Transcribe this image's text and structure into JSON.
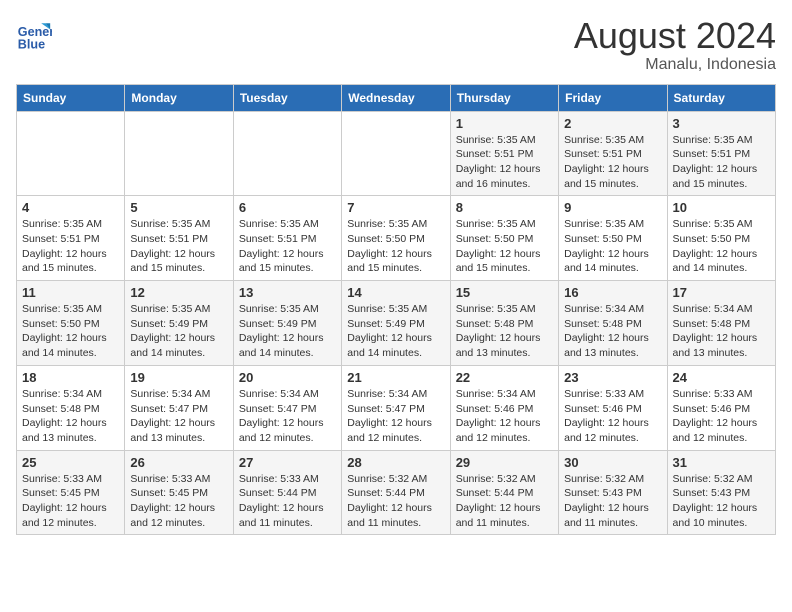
{
  "header": {
    "logo_line1": "General",
    "logo_line2": "Blue",
    "month_year": "August 2024",
    "location": "Manalu, Indonesia"
  },
  "weekdays": [
    "Sunday",
    "Monday",
    "Tuesday",
    "Wednesday",
    "Thursday",
    "Friday",
    "Saturday"
  ],
  "weeks": [
    [
      {
        "day": "",
        "info": ""
      },
      {
        "day": "",
        "info": ""
      },
      {
        "day": "",
        "info": ""
      },
      {
        "day": "",
        "info": ""
      },
      {
        "day": "1",
        "info": "Sunrise: 5:35 AM\nSunset: 5:51 PM\nDaylight: 12 hours\nand 16 minutes."
      },
      {
        "day": "2",
        "info": "Sunrise: 5:35 AM\nSunset: 5:51 PM\nDaylight: 12 hours\nand 15 minutes."
      },
      {
        "day": "3",
        "info": "Sunrise: 5:35 AM\nSunset: 5:51 PM\nDaylight: 12 hours\nand 15 minutes."
      }
    ],
    [
      {
        "day": "4",
        "info": "Sunrise: 5:35 AM\nSunset: 5:51 PM\nDaylight: 12 hours\nand 15 minutes."
      },
      {
        "day": "5",
        "info": "Sunrise: 5:35 AM\nSunset: 5:51 PM\nDaylight: 12 hours\nand 15 minutes."
      },
      {
        "day": "6",
        "info": "Sunrise: 5:35 AM\nSunset: 5:51 PM\nDaylight: 12 hours\nand 15 minutes."
      },
      {
        "day": "7",
        "info": "Sunrise: 5:35 AM\nSunset: 5:50 PM\nDaylight: 12 hours\nand 15 minutes."
      },
      {
        "day": "8",
        "info": "Sunrise: 5:35 AM\nSunset: 5:50 PM\nDaylight: 12 hours\nand 15 minutes."
      },
      {
        "day": "9",
        "info": "Sunrise: 5:35 AM\nSunset: 5:50 PM\nDaylight: 12 hours\nand 14 minutes."
      },
      {
        "day": "10",
        "info": "Sunrise: 5:35 AM\nSunset: 5:50 PM\nDaylight: 12 hours\nand 14 minutes."
      }
    ],
    [
      {
        "day": "11",
        "info": "Sunrise: 5:35 AM\nSunset: 5:50 PM\nDaylight: 12 hours\nand 14 minutes."
      },
      {
        "day": "12",
        "info": "Sunrise: 5:35 AM\nSunset: 5:49 PM\nDaylight: 12 hours\nand 14 minutes."
      },
      {
        "day": "13",
        "info": "Sunrise: 5:35 AM\nSunset: 5:49 PM\nDaylight: 12 hours\nand 14 minutes."
      },
      {
        "day": "14",
        "info": "Sunrise: 5:35 AM\nSunset: 5:49 PM\nDaylight: 12 hours\nand 14 minutes."
      },
      {
        "day": "15",
        "info": "Sunrise: 5:35 AM\nSunset: 5:48 PM\nDaylight: 12 hours\nand 13 minutes."
      },
      {
        "day": "16",
        "info": "Sunrise: 5:34 AM\nSunset: 5:48 PM\nDaylight: 12 hours\nand 13 minutes."
      },
      {
        "day": "17",
        "info": "Sunrise: 5:34 AM\nSunset: 5:48 PM\nDaylight: 12 hours\nand 13 minutes."
      }
    ],
    [
      {
        "day": "18",
        "info": "Sunrise: 5:34 AM\nSunset: 5:48 PM\nDaylight: 12 hours\nand 13 minutes."
      },
      {
        "day": "19",
        "info": "Sunrise: 5:34 AM\nSunset: 5:47 PM\nDaylight: 12 hours\nand 13 minutes."
      },
      {
        "day": "20",
        "info": "Sunrise: 5:34 AM\nSunset: 5:47 PM\nDaylight: 12 hours\nand 12 minutes."
      },
      {
        "day": "21",
        "info": "Sunrise: 5:34 AM\nSunset: 5:47 PM\nDaylight: 12 hours\nand 12 minutes."
      },
      {
        "day": "22",
        "info": "Sunrise: 5:34 AM\nSunset: 5:46 PM\nDaylight: 12 hours\nand 12 minutes."
      },
      {
        "day": "23",
        "info": "Sunrise: 5:33 AM\nSunset: 5:46 PM\nDaylight: 12 hours\nand 12 minutes."
      },
      {
        "day": "24",
        "info": "Sunrise: 5:33 AM\nSunset: 5:46 PM\nDaylight: 12 hours\nand 12 minutes."
      }
    ],
    [
      {
        "day": "25",
        "info": "Sunrise: 5:33 AM\nSunset: 5:45 PM\nDaylight: 12 hours\nand 12 minutes."
      },
      {
        "day": "26",
        "info": "Sunrise: 5:33 AM\nSunset: 5:45 PM\nDaylight: 12 hours\nand 12 minutes."
      },
      {
        "day": "27",
        "info": "Sunrise: 5:33 AM\nSunset: 5:44 PM\nDaylight: 12 hours\nand 11 minutes."
      },
      {
        "day": "28",
        "info": "Sunrise: 5:32 AM\nSunset: 5:44 PM\nDaylight: 12 hours\nand 11 minutes."
      },
      {
        "day": "29",
        "info": "Sunrise: 5:32 AM\nSunset: 5:44 PM\nDaylight: 12 hours\nand 11 minutes."
      },
      {
        "day": "30",
        "info": "Sunrise: 5:32 AM\nSunset: 5:43 PM\nDaylight: 12 hours\nand 11 minutes."
      },
      {
        "day": "31",
        "info": "Sunrise: 5:32 AM\nSunset: 5:43 PM\nDaylight: 12 hours\nand 10 minutes."
      }
    ]
  ]
}
